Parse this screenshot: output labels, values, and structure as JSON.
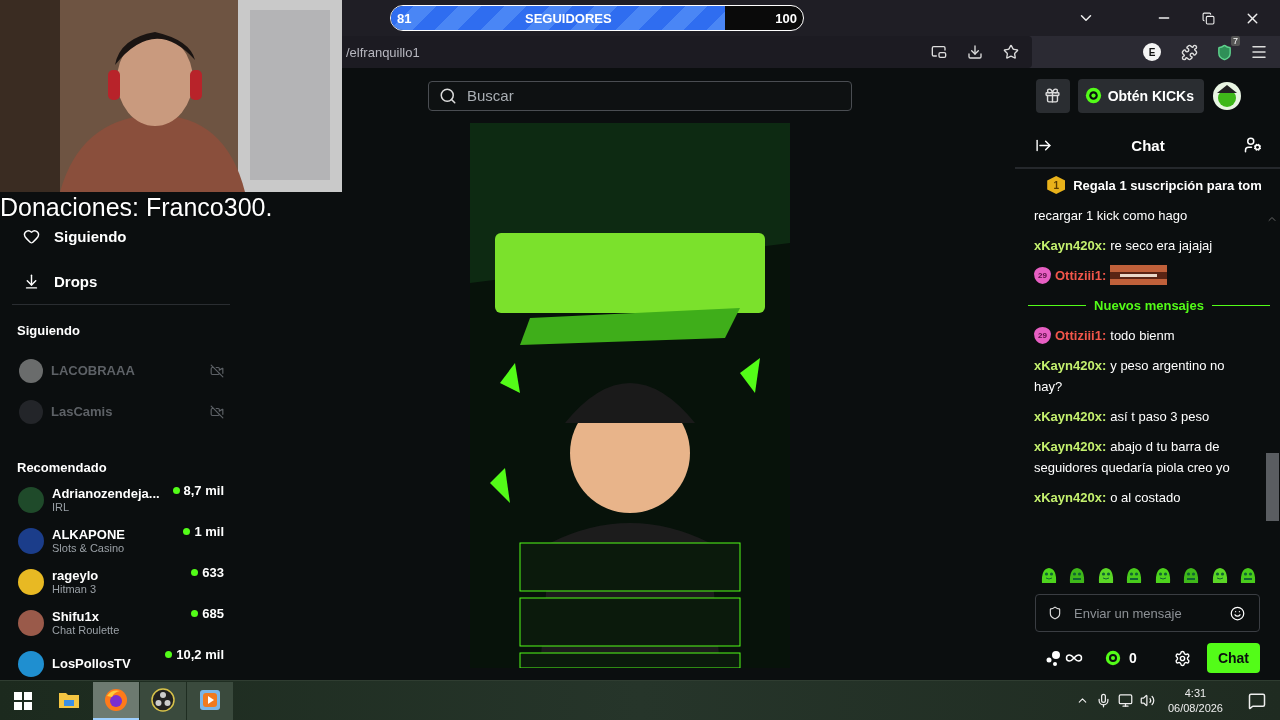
{
  "follower_goal": {
    "current": "81",
    "label": "SEGUIDORES",
    "target": "100",
    "level": 0.81
  },
  "browser": {
    "url": "/elfranquillo1",
    "profile_initial": "E",
    "extension_badge": "7"
  },
  "caption": "Donaciones: Franco300.",
  "header": {
    "search_placeholder": "Buscar",
    "kicks_button": "Obtén KICKs"
  },
  "sidebar": {
    "nav": [
      {
        "kind": "heart",
        "label": "Siguiendo"
      },
      {
        "kind": "drops",
        "label": "Drops"
      }
    ],
    "following_title": "Siguiendo",
    "following": [
      {
        "name": "LACOBRAAA",
        "live": false
      },
      {
        "name": "LasCamis",
        "live": false
      }
    ],
    "recommended_title": "Recomendado",
    "recommended": [
      {
        "name": "Adrianozendeja...",
        "category": "IRL",
        "viewers": "8,7 mil"
      },
      {
        "name": "ALKAPONE",
        "category": "Slots & Casino",
        "viewers": "1 mil"
      },
      {
        "name": "rageylo",
        "category": "Hitman 3",
        "viewers": "633"
      },
      {
        "name": "Shifu1x",
        "category": "Chat Roulette",
        "viewers": "685"
      },
      {
        "name": "LosPollosTV",
        "viewers": "10,2 mil"
      }
    ]
  },
  "chat": {
    "title": "Chat",
    "pinned": {
      "count": "1",
      "text": "Regala 1 suscripción para tom"
    },
    "messages": [
      {
        "kind": "text",
        "text": "recargar 1 kick como hago"
      },
      {
        "kind": "message",
        "user": "xKayn420x:",
        "color": "#c4f06e",
        "text": "re seco era jajajaj"
      },
      {
        "kind": "emote",
        "user": "Ottiziii1:",
        "color": "#f2564a",
        "badge": "29"
      },
      {
        "kind": "divider",
        "text": "Nuevos mensajes"
      },
      {
        "kind": "message",
        "user": "Ottiziii1:",
        "color": "#f2564a",
        "badge": "29",
        "text": "todo bienm"
      },
      {
        "kind": "message",
        "user": "xKayn420x:",
        "color": "#c4f06e",
        "text": "y peso argentino no hay?"
      },
      {
        "kind": "message",
        "user": "xKayn420x:",
        "color": "#c4f06e",
        "text": "así t paso 3 peso"
      },
      {
        "kind": "message",
        "user": "xKayn420x:",
        "color": "#c4f06e",
        "text": "abajo d tu barra de seguidores quedaría piola creo yo"
      },
      {
        "kind": "message",
        "user": "xKayn420x:",
        "color": "#c4f06e",
        "text": "o al costado"
      }
    ],
    "placeholder": "Enviar un mensaje",
    "kicks": "0",
    "send_button": "Chat"
  },
  "taskbar": {
    "apps": [
      {
        "kind": "explorer",
        "selected": false
      },
      {
        "kind": "firefox",
        "selected": true
      },
      {
        "kind": "obs",
        "selected": false
      },
      {
        "kind": "media",
        "selected": false
      }
    ],
    "time": "4:31",
    "date": "06/08/2026"
  }
}
